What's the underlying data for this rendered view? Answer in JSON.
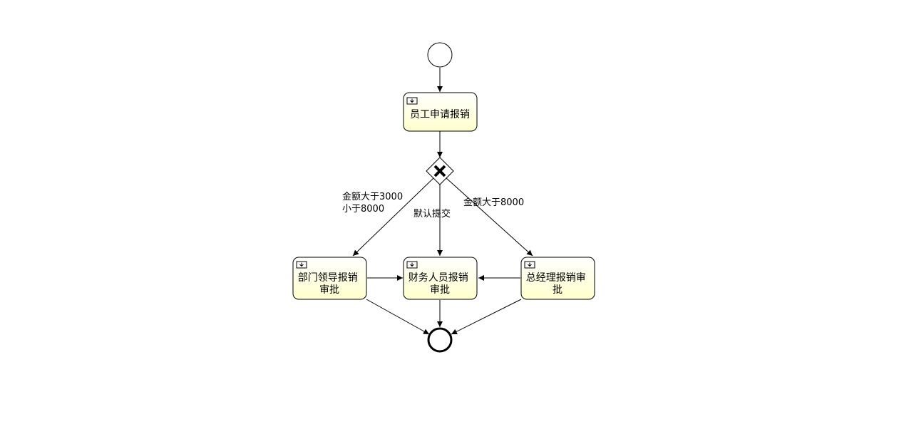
{
  "diagram": {
    "tasks": {
      "apply": {
        "lines": [
          "员工申请报销"
        ]
      },
      "dept": {
        "lines": [
          "部门领导报销",
          "审批"
        ]
      },
      "finance": {
        "lines": [
          "财务人员报销",
          "审批"
        ]
      },
      "gm": {
        "lines": [
          "总经理报销审",
          "批"
        ]
      }
    },
    "flows": {
      "to_dept": {
        "lines": [
          "金额大于3000",
          "小于8000"
        ]
      },
      "to_finance": {
        "lines": [
          "默认提交"
        ]
      },
      "to_gm": {
        "lines": [
          "金额大于8000"
        ]
      }
    },
    "colors": {
      "task_fill_top": "#ffffff",
      "task_fill_bottom": "#ffffcc",
      "stroke": "#000000"
    }
  }
}
